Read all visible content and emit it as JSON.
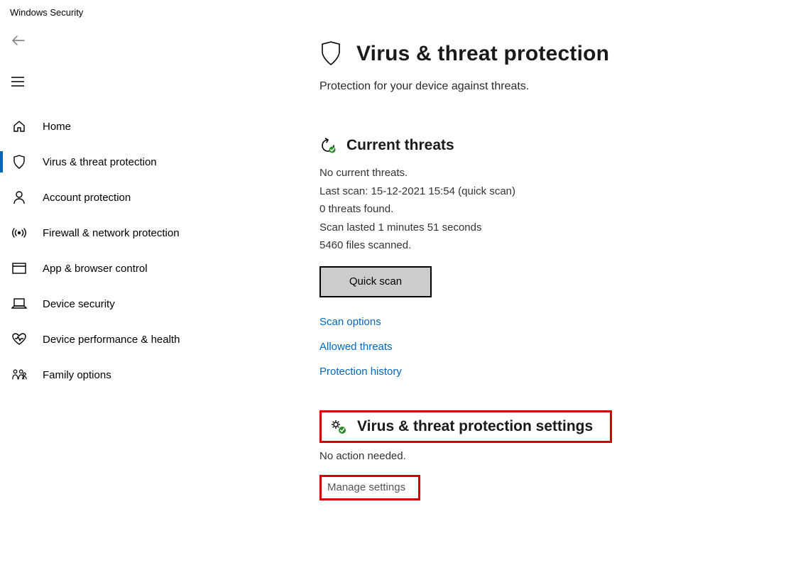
{
  "window": {
    "title": "Windows Security"
  },
  "sidebar": {
    "items": [
      {
        "label": "Home"
      },
      {
        "label": "Virus & threat protection"
      },
      {
        "label": "Account protection"
      },
      {
        "label": "Firewall & network protection"
      },
      {
        "label": "App & browser control"
      },
      {
        "label": "Device security"
      },
      {
        "label": "Device performance & health"
      },
      {
        "label": "Family options"
      }
    ]
  },
  "page": {
    "heading": "Virus & threat protection",
    "subheading": "Protection for your device against threats."
  },
  "current_threats": {
    "heading": "Current threats",
    "no_threats": "No current threats.",
    "last_scan": "Last scan: 15-12-2021 15:54 (quick scan)",
    "threats_found": "0 threats found.",
    "scan_duration": "Scan lasted 1 minutes 51 seconds",
    "files_scanned": "5460 files scanned.",
    "quick_scan_label": "Quick scan",
    "links": {
      "scan_options": "Scan options",
      "allowed_threats": "Allowed threats",
      "protection_history": "Protection history"
    }
  },
  "settings": {
    "heading": "Virus & threat protection settings",
    "subheading": "No action needed.",
    "manage_link": "Manage settings"
  }
}
